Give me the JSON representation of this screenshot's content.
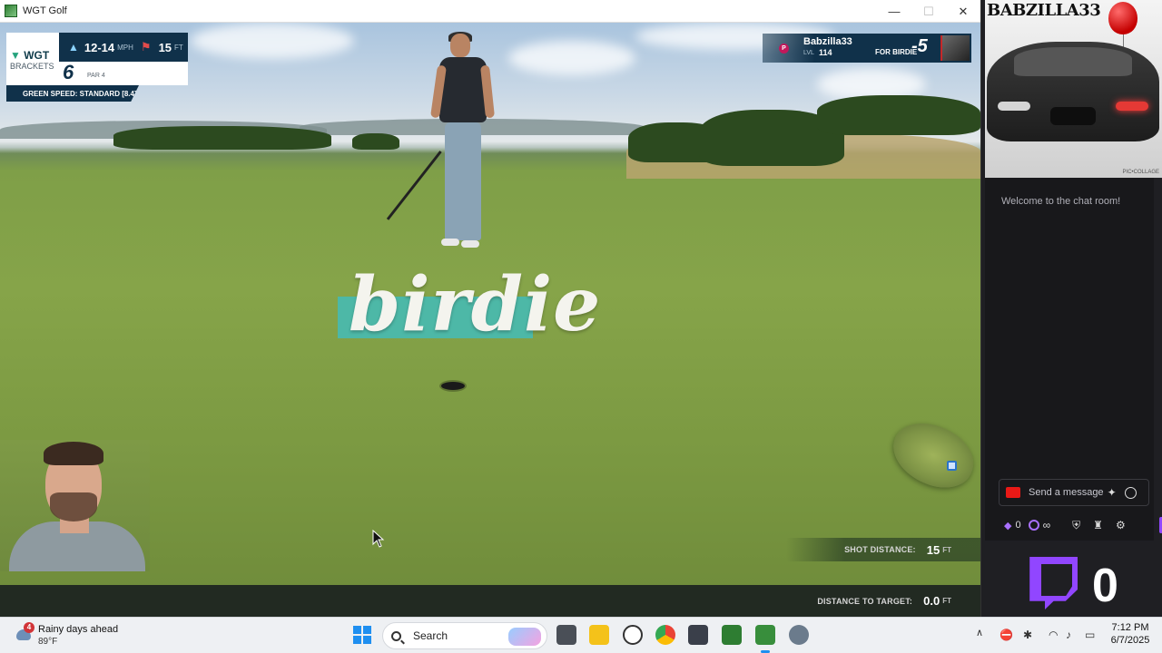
{
  "window": {
    "title": "WGT Golf"
  },
  "hud": {
    "logo": "WGT",
    "logo_sub": "BRACKETS",
    "wind_speed": "12-14",
    "wind_unit": "MPH",
    "pin_distance": "15",
    "pin_unit": "FT",
    "hole_number": "6",
    "par": "PAR 4",
    "green_speed": "GREEN SPEED: STANDARD [8.4]",
    "player_name": "Babzilla33",
    "level_label": "LVL",
    "level": "114",
    "for_label": "FOR BIRDIE",
    "score": "-5",
    "player_badge": "P"
  },
  "result_banner": "birdie",
  "shot": {
    "shot_distance_label": "SHOT DISTANCE:",
    "shot_distance_value": "15",
    "shot_distance_unit": "FT",
    "target_label": "DISTANCE TO TARGET:",
    "target_value": "0.0",
    "target_unit": "FT"
  },
  "stream": {
    "channel_banner": "BABZILLA33",
    "banner_credit": "PIC•COLLAGE",
    "chat_welcome": "Welcome to the chat room!",
    "chat_placeholder": "Send a message",
    "points": "0",
    "infinity": "∞",
    "viewer_count": "0",
    "accent_color": "#9146ff"
  },
  "taskbar": {
    "weather_title": "Rainy days ahead",
    "weather_temp": "89°F",
    "weather_badge": "4",
    "search_label": "Search",
    "time": "7:12 PM",
    "date": "6/7/2025",
    "accent_color": "#1f8ff0"
  }
}
